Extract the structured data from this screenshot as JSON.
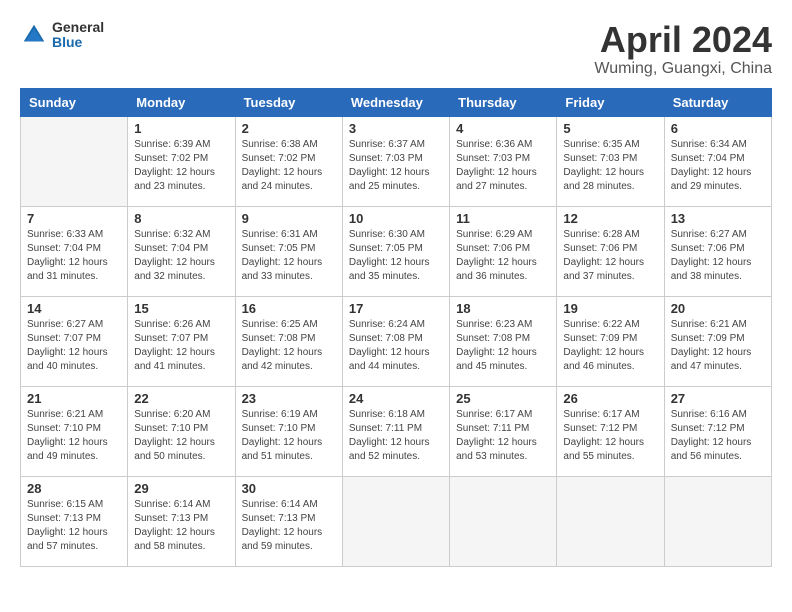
{
  "header": {
    "logo_general": "General",
    "logo_blue": "Blue",
    "month_title": "April 2024",
    "location": "Wuming, Guangxi, China"
  },
  "columns": [
    "Sunday",
    "Monday",
    "Tuesday",
    "Wednesday",
    "Thursday",
    "Friday",
    "Saturday"
  ],
  "weeks": [
    [
      {
        "day": "",
        "empty": true
      },
      {
        "day": "1",
        "sunrise": "6:39 AM",
        "sunset": "7:02 PM",
        "daylight": "12 hours and 23 minutes."
      },
      {
        "day": "2",
        "sunrise": "6:38 AM",
        "sunset": "7:02 PM",
        "daylight": "12 hours and 24 minutes."
      },
      {
        "day": "3",
        "sunrise": "6:37 AM",
        "sunset": "7:03 PM",
        "daylight": "12 hours and 25 minutes."
      },
      {
        "day": "4",
        "sunrise": "6:36 AM",
        "sunset": "7:03 PM",
        "daylight": "12 hours and 27 minutes."
      },
      {
        "day": "5",
        "sunrise": "6:35 AM",
        "sunset": "7:03 PM",
        "daylight": "12 hours and 28 minutes."
      },
      {
        "day": "6",
        "sunrise": "6:34 AM",
        "sunset": "7:04 PM",
        "daylight": "12 hours and 29 minutes."
      }
    ],
    [
      {
        "day": "7",
        "sunrise": "6:33 AM",
        "sunset": "7:04 PM",
        "daylight": "12 hours and 31 minutes."
      },
      {
        "day": "8",
        "sunrise": "6:32 AM",
        "sunset": "7:04 PM",
        "daylight": "12 hours and 32 minutes."
      },
      {
        "day": "9",
        "sunrise": "6:31 AM",
        "sunset": "7:05 PM",
        "daylight": "12 hours and 33 minutes."
      },
      {
        "day": "10",
        "sunrise": "6:30 AM",
        "sunset": "7:05 PM",
        "daylight": "12 hours and 35 minutes."
      },
      {
        "day": "11",
        "sunrise": "6:29 AM",
        "sunset": "7:06 PM",
        "daylight": "12 hours and 36 minutes."
      },
      {
        "day": "12",
        "sunrise": "6:28 AM",
        "sunset": "7:06 PM",
        "daylight": "12 hours and 37 minutes."
      },
      {
        "day": "13",
        "sunrise": "6:27 AM",
        "sunset": "7:06 PM",
        "daylight": "12 hours and 38 minutes."
      }
    ],
    [
      {
        "day": "14",
        "sunrise": "6:27 AM",
        "sunset": "7:07 PM",
        "daylight": "12 hours and 40 minutes."
      },
      {
        "day": "15",
        "sunrise": "6:26 AM",
        "sunset": "7:07 PM",
        "daylight": "12 hours and 41 minutes."
      },
      {
        "day": "16",
        "sunrise": "6:25 AM",
        "sunset": "7:08 PM",
        "daylight": "12 hours and 42 minutes."
      },
      {
        "day": "17",
        "sunrise": "6:24 AM",
        "sunset": "7:08 PM",
        "daylight": "12 hours and 44 minutes."
      },
      {
        "day": "18",
        "sunrise": "6:23 AM",
        "sunset": "7:08 PM",
        "daylight": "12 hours and 45 minutes."
      },
      {
        "day": "19",
        "sunrise": "6:22 AM",
        "sunset": "7:09 PM",
        "daylight": "12 hours and 46 minutes."
      },
      {
        "day": "20",
        "sunrise": "6:21 AM",
        "sunset": "7:09 PM",
        "daylight": "12 hours and 47 minutes."
      }
    ],
    [
      {
        "day": "21",
        "sunrise": "6:21 AM",
        "sunset": "7:10 PM",
        "daylight": "12 hours and 49 minutes."
      },
      {
        "day": "22",
        "sunrise": "6:20 AM",
        "sunset": "7:10 PM",
        "daylight": "12 hours and 50 minutes."
      },
      {
        "day": "23",
        "sunrise": "6:19 AM",
        "sunset": "7:10 PM",
        "daylight": "12 hours and 51 minutes."
      },
      {
        "day": "24",
        "sunrise": "6:18 AM",
        "sunset": "7:11 PM",
        "daylight": "12 hours and 52 minutes."
      },
      {
        "day": "25",
        "sunrise": "6:17 AM",
        "sunset": "7:11 PM",
        "daylight": "12 hours and 53 minutes."
      },
      {
        "day": "26",
        "sunrise": "6:17 AM",
        "sunset": "7:12 PM",
        "daylight": "12 hours and 55 minutes."
      },
      {
        "day": "27",
        "sunrise": "6:16 AM",
        "sunset": "7:12 PM",
        "daylight": "12 hours and 56 minutes."
      }
    ],
    [
      {
        "day": "28",
        "sunrise": "6:15 AM",
        "sunset": "7:13 PM",
        "daylight": "12 hours and 57 minutes."
      },
      {
        "day": "29",
        "sunrise": "6:14 AM",
        "sunset": "7:13 PM",
        "daylight": "12 hours and 58 minutes."
      },
      {
        "day": "30",
        "sunrise": "6:14 AM",
        "sunset": "7:13 PM",
        "daylight": "12 hours and 59 minutes."
      },
      {
        "day": "",
        "empty": true
      },
      {
        "day": "",
        "empty": true
      },
      {
        "day": "",
        "empty": true
      },
      {
        "day": "",
        "empty": true
      }
    ]
  ],
  "labels": {
    "sunrise": "Sunrise:",
    "sunset": "Sunset:",
    "daylight": "Daylight:"
  }
}
